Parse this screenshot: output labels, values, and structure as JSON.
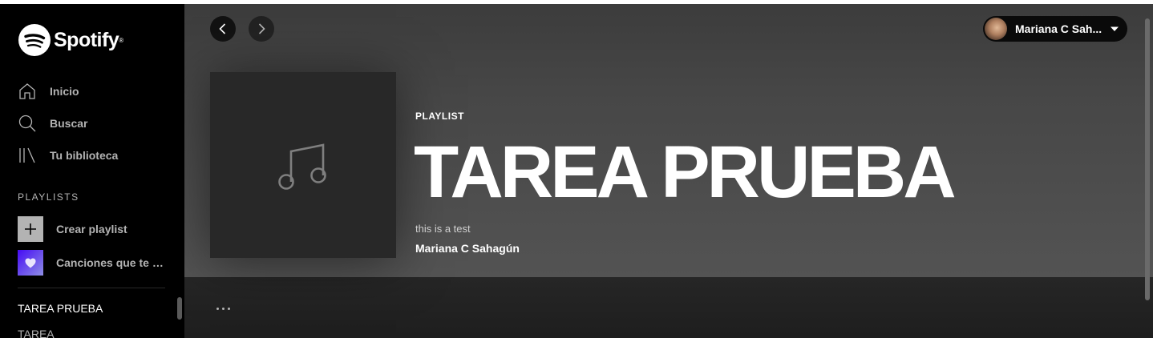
{
  "app": {
    "brand": "Spotify",
    "accent_color": "#1db954"
  },
  "sidebar": {
    "nav": [
      {
        "label": "Inicio",
        "icon": "home-icon"
      },
      {
        "label": "Buscar",
        "icon": "search-icon"
      },
      {
        "label": "Tu biblioteca",
        "icon": "library-icon"
      }
    ],
    "playlists_header": "PLAYLISTS",
    "create_playlist": "Crear playlist",
    "liked_songs": "Canciones que te gustan",
    "playlist_items": [
      "TAREA PRUEBA",
      "TAREA"
    ]
  },
  "header": {
    "user_name": "Mariana C Sahagún",
    "user_name_display": "Mariana C Sah..."
  },
  "playlist": {
    "type_label": "PLAYLIST",
    "title": "TAREA PRUEBA",
    "description": "this is a test",
    "owner": "Mariana C Sahagún"
  },
  "actions": {
    "more": "• • •"
  }
}
